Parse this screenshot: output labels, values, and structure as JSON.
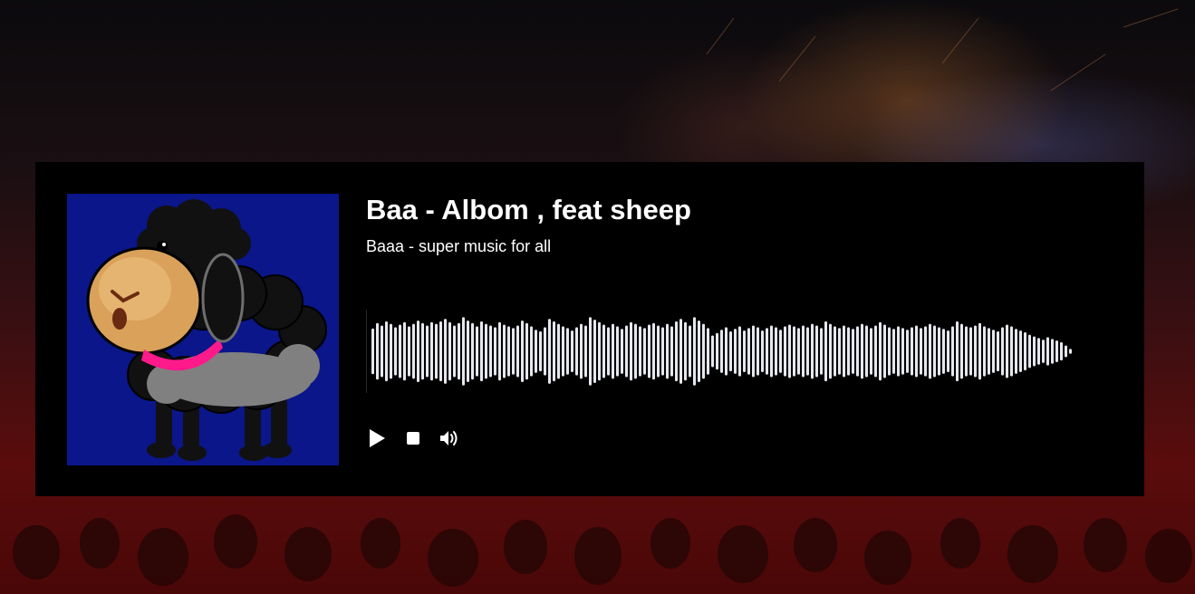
{
  "track": {
    "title": "Baa - Albom , feat sheep",
    "subtitle": "Baaa - super music for all"
  },
  "controls": {
    "play_icon": "play-icon",
    "stop_icon": "stop-icon",
    "volume_icon": "volume-icon"
  },
  "colors": {
    "card_background": "#000000",
    "cover_background": "#0a168a",
    "waveform_bar": "#e6e8ee",
    "text": "#ffffff"
  },
  "waveform": {
    "progress": 0,
    "bars": [
      0.55,
      0.68,
      0.62,
      0.72,
      0.66,
      0.58,
      0.64,
      0.7,
      0.6,
      0.66,
      0.74,
      0.68,
      0.62,
      0.7,
      0.66,
      0.72,
      0.78,
      0.7,
      0.62,
      0.68,
      0.82,
      0.74,
      0.68,
      0.6,
      0.72,
      0.66,
      0.62,
      0.58,
      0.7,
      0.64,
      0.6,
      0.56,
      0.62,
      0.74,
      0.68,
      0.6,
      0.52,
      0.48,
      0.58,
      0.78,
      0.72,
      0.66,
      0.6,
      0.56,
      0.5,
      0.58,
      0.66,
      0.62,
      0.82,
      0.76,
      0.7,
      0.64,
      0.58,
      0.66,
      0.6,
      0.54,
      0.62,
      0.7,
      0.66,
      0.6,
      0.56,
      0.64,
      0.68,
      0.62,
      0.58,
      0.66,
      0.6,
      0.72,
      0.78,
      0.7,
      0.62,
      0.82,
      0.74,
      0.66,
      0.56,
      0.38,
      0.44,
      0.52,
      0.58,
      0.48,
      0.54,
      0.6,
      0.5,
      0.56,
      0.62,
      0.58,
      0.5,
      0.56,
      0.62,
      0.58,
      0.52,
      0.6,
      0.64,
      0.6,
      0.56,
      0.62,
      0.58,
      0.66,
      0.62,
      0.56,
      0.72,
      0.66,
      0.6,
      0.56,
      0.62,
      0.58,
      0.54,
      0.6,
      0.66,
      0.62,
      0.56,
      0.62,
      0.7,
      0.64,
      0.58,
      0.54,
      0.6,
      0.56,
      0.52,
      0.58,
      0.62,
      0.56,
      0.6,
      0.66,
      0.62,
      0.58,
      0.54,
      0.5,
      0.6,
      0.72,
      0.66,
      0.6,
      0.58,
      0.62,
      0.68,
      0.6,
      0.56,
      0.52,
      0.48,
      0.58,
      0.64,
      0.6,
      0.54,
      0.5,
      0.46,
      0.4,
      0.36,
      0.32,
      0.28,
      0.34,
      0.3,
      0.26,
      0.22,
      0.14,
      0.06,
      0.04
    ]
  }
}
